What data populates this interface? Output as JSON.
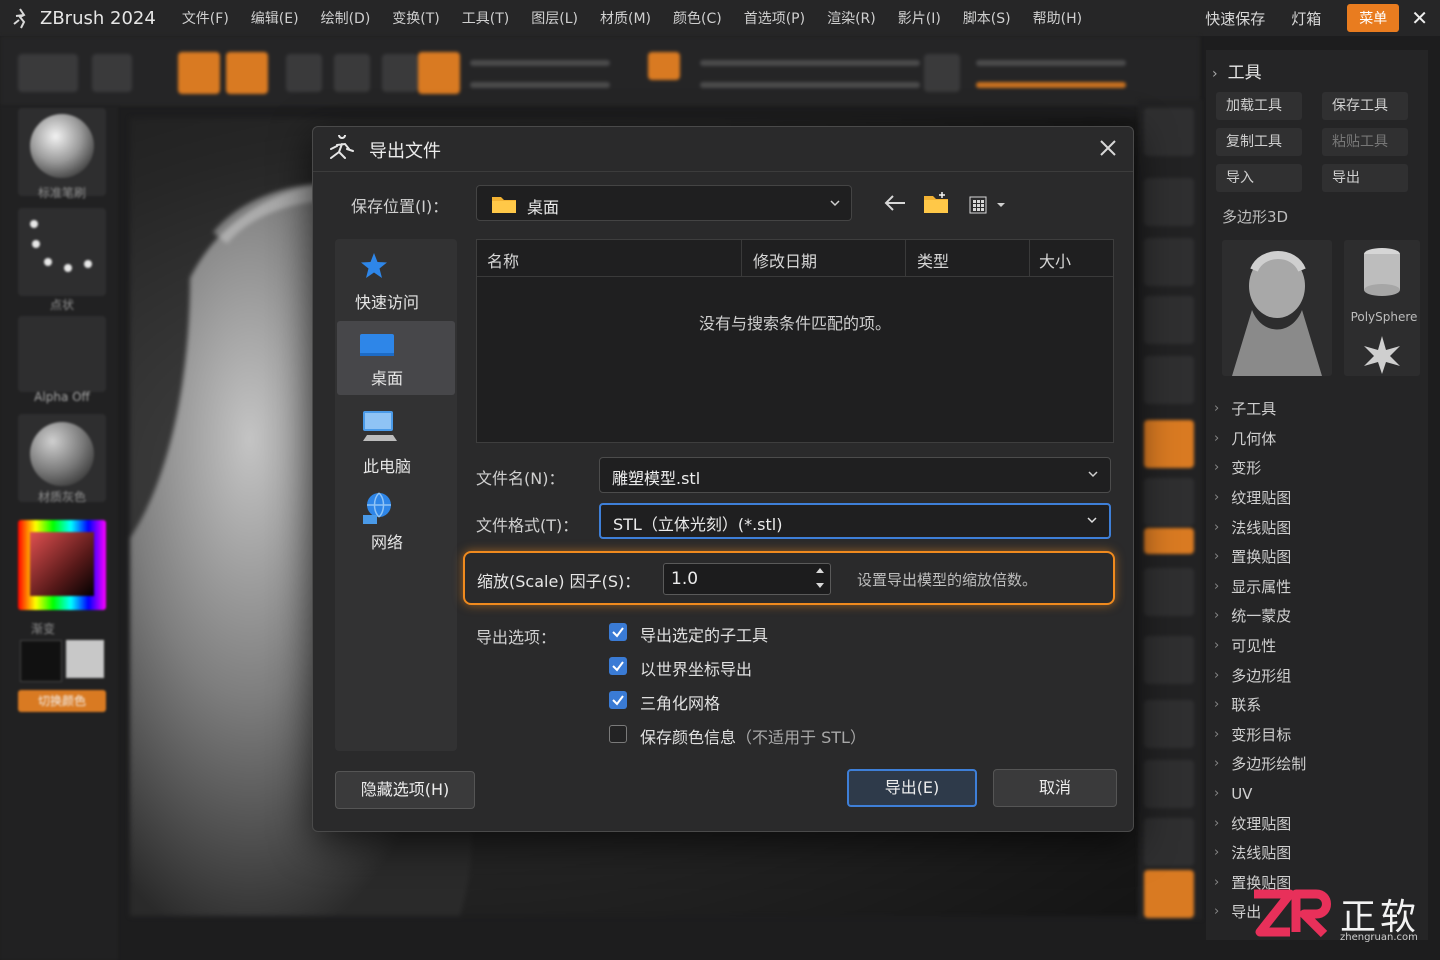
{
  "app": {
    "title": "ZBrush 2024",
    "menus": [
      "文件(F)",
      "编辑(E)",
      "绘制(D)",
      "变换(T)",
      "工具(T)",
      "图层(L)",
      "材质(M)",
      "颜色(C)",
      "首选项(P)",
      "渲染(R)",
      "影片(I)",
      "脚本(S)",
      "帮助(H)"
    ],
    "quicksave": "快速保存",
    "lightbox": "灯箱",
    "menu_button": "菜单",
    "accent_color": "#e97c1f"
  },
  "left_shelf": {
    "brush_label": "标准笔刷",
    "stroke_label": "点状",
    "alpha_label": "Alpha Off",
    "material_label": "材质灰色",
    "gradient_label": "渐变",
    "switch_color_label": "切换颜色"
  },
  "tool_palette": {
    "header": "工具",
    "buttons": [
      "加载工具",
      "保存工具",
      "复制工具",
      "粘贴工具",
      "导入",
      "导出"
    ],
    "current_tool": "多边形3D",
    "polysphere_label": "PolySphere",
    "sections": [
      "子工具",
      "几何体",
      "变形",
      "纹理贴图",
      "法线贴图",
      "置换贴图",
      "显示属性",
      "统一蒙皮",
      "可见性",
      "多边形组",
      "联系",
      "变形目标",
      "多边形绘制",
      "UV",
      "纹理贴图",
      "法线贴图",
      "置换贴图",
      "导出"
    ]
  },
  "dialog": {
    "title": "导出文件",
    "save_in_label": "保存位置(I)：",
    "location": "桌面",
    "places": [
      "快速访问",
      "桌面",
      "此电脑",
      "网络"
    ],
    "active_place": "桌面",
    "columns": [
      "名称",
      "修改日期",
      "类型",
      "大小"
    ],
    "empty_message": "没有与搜索条件匹配的项。",
    "filename_label": "文件名(N)：",
    "filename_value": "雕塑模型.stl",
    "format_label": "文件格式(T)：",
    "format_value": "STL（立体光刻）(*.stl)",
    "scale_label": "缩放(Scale) 因子(S)：",
    "scale_value": "1.0",
    "scale_hint": "设置导出模型的缩放倍数。",
    "options_label": "导出选项：",
    "options": [
      {
        "label": "导出选定的子工具",
        "note": "",
        "checked": true
      },
      {
        "label": "以世界坐标导出",
        "note": "",
        "checked": true
      },
      {
        "label": "三角化网格",
        "note": "",
        "checked": true
      },
      {
        "label": "保存颜色信息",
        "note": "（不适用于 STL）",
        "checked": false
      }
    ],
    "hide_options_button": "隐藏选项(H)",
    "export_button": "导出(E)",
    "cancel_button": "取消",
    "highlight_color": "#f08a1e",
    "focus_color": "#3e7fd8"
  },
  "watermark": {
    "text": "正软",
    "url": "zhengruan.com"
  }
}
